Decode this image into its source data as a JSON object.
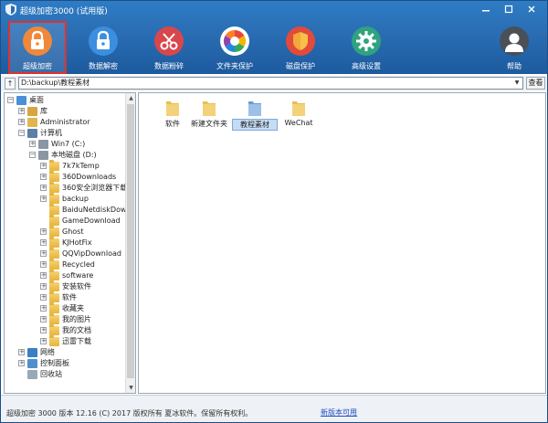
{
  "window": {
    "title": "超级加密3000 (试用版)"
  },
  "colors": {
    "accent": "#2a6db3",
    "selected_border": "#e0322b"
  },
  "toolbar": [
    {
      "label": "超级加密",
      "icon": "lock-icon",
      "color": "#f0883a",
      "active": true
    },
    {
      "label": "数据解密",
      "icon": "lock-icon",
      "color": "#3a8fe0"
    },
    {
      "label": "数据粉碎",
      "icon": "scissors-icon",
      "color": "#d8474b"
    },
    {
      "label": "文件夹保护",
      "icon": "color-wheel-icon",
      "color": "#ffffff"
    },
    {
      "label": "磁盘保护",
      "icon": "shield-icon",
      "color": "#e24a3b"
    },
    {
      "label": "高级设置",
      "icon": "gear-icon",
      "color": "#2fa37f"
    },
    {
      "label": "帮助",
      "icon": "user-icon",
      "color": "#4a4f58"
    }
  ],
  "address": {
    "up": "↑",
    "value": "D:\\backup\\教程素材",
    "view_button": "查看"
  },
  "tree": [
    {
      "label": "桌面",
      "level": 0,
      "exp": "−",
      "icon": "desktop-icon"
    },
    {
      "label": "库",
      "level": 1,
      "exp": "+",
      "icon": "library-icon"
    },
    {
      "label": "Administrator",
      "level": 1,
      "exp": "+",
      "icon": "user-folder-icon"
    },
    {
      "label": "计算机",
      "level": 1,
      "exp": "−",
      "icon": "computer-icon"
    },
    {
      "label": "Win7 (C:)",
      "level": 2,
      "exp": "+",
      "icon": "drive-icon"
    },
    {
      "label": "本地磁盘 (D:)",
      "level": 2,
      "exp": "−",
      "icon": "drive-icon"
    },
    {
      "label": "7k7kTemp",
      "level": 3,
      "exp": "+",
      "icon": "folder-icon"
    },
    {
      "label": "360Downloads",
      "level": 3,
      "exp": "+",
      "icon": "folder-icon"
    },
    {
      "label": "360安全浏览器下载",
      "level": 3,
      "exp": "+",
      "icon": "folder-icon"
    },
    {
      "label": "backup",
      "level": 3,
      "exp": "+",
      "icon": "folder-icon"
    },
    {
      "label": "BaiduNetdiskDownload",
      "level": 3,
      "exp": "",
      "icon": "folder-icon"
    },
    {
      "label": "GameDownload",
      "level": 3,
      "exp": "",
      "icon": "folder-icon"
    },
    {
      "label": "Ghost",
      "level": 3,
      "exp": "+",
      "icon": "folder-icon"
    },
    {
      "label": "KJHotFix",
      "level": 3,
      "exp": "+",
      "icon": "folder-icon"
    },
    {
      "label": "QQVipDownload",
      "level": 3,
      "exp": "+",
      "icon": "folder-icon"
    },
    {
      "label": "Recycled",
      "level": 3,
      "exp": "+",
      "icon": "folder-icon"
    },
    {
      "label": "software",
      "level": 3,
      "exp": "+",
      "icon": "folder-icon"
    },
    {
      "label": "安装软件",
      "level": 3,
      "exp": "+",
      "icon": "folder-icon"
    },
    {
      "label": "软件",
      "level": 3,
      "exp": "+",
      "icon": "folder-icon"
    },
    {
      "label": "收藏夹",
      "level": 3,
      "exp": "+",
      "icon": "folder-icon"
    },
    {
      "label": "我的图片",
      "level": 3,
      "exp": "+",
      "icon": "folder-icon"
    },
    {
      "label": "我的文档",
      "level": 3,
      "exp": "+",
      "icon": "folder-icon"
    },
    {
      "label": "迅雷下载",
      "level": 3,
      "exp": "+",
      "icon": "folder-icon"
    },
    {
      "label": "网络",
      "level": 1,
      "exp": "+",
      "icon": "network-icon"
    },
    {
      "label": "控制面板",
      "level": 1,
      "exp": "+",
      "icon": "control-panel-icon"
    },
    {
      "label": "回收站",
      "level": 1,
      "exp": "",
      "icon": "recycle-bin-icon"
    }
  ],
  "files": [
    {
      "label": "软件",
      "selected": false,
      "color": "#e8bf4e"
    },
    {
      "label": "新建文件夹",
      "selected": false,
      "color": "#e8bf4e"
    },
    {
      "label": "教程素材",
      "selected": true,
      "color": "#7aa7d8"
    },
    {
      "label": "WeChat",
      "selected": false,
      "color": "#e8bf4e"
    }
  ],
  "status": {
    "text": "超级加密 3000  版本 12.16 (C) 2017 版权所有 夏冰软件。保留所有权利。",
    "link": "新版本可用"
  }
}
